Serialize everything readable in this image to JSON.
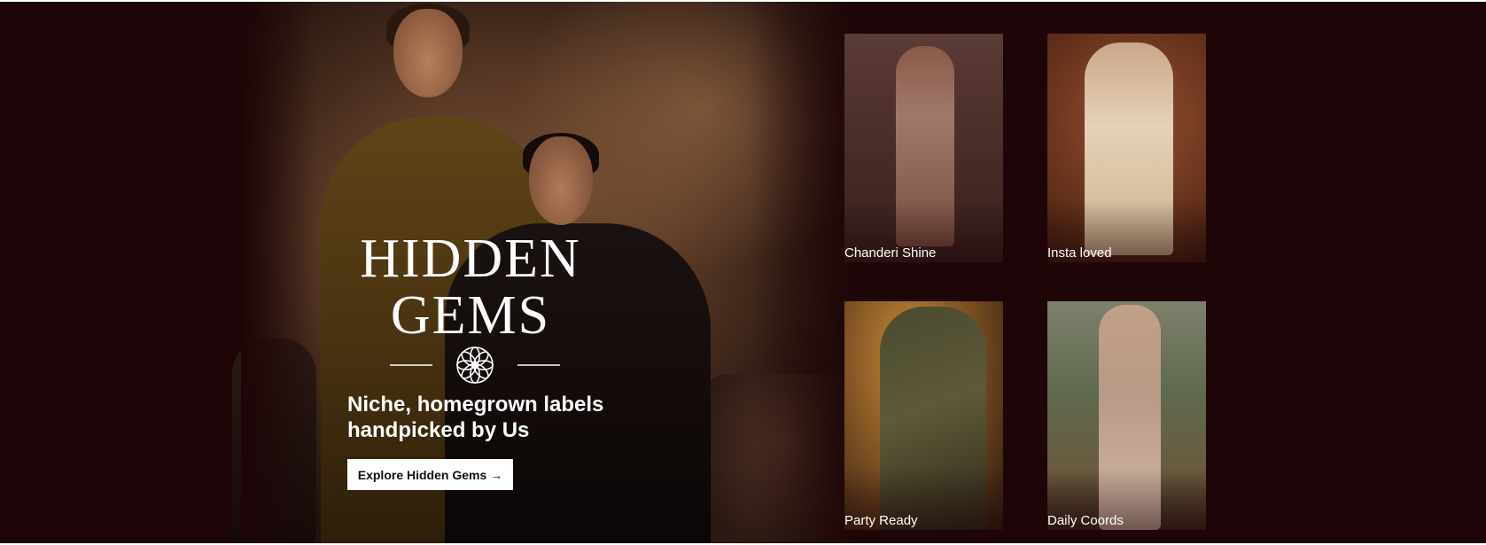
{
  "hero": {
    "logo_line1": "HIDDEN",
    "logo_line2": "GEMS",
    "tagline_line1": "Niche, homegrown labels",
    "tagline_line2": "handpicked by Us",
    "cta_label": "Explore Hidden Gems",
    "cta_arrow": "→"
  },
  "tiles": [
    {
      "label": "Chanderi Shine"
    },
    {
      "label": "Insta loved"
    },
    {
      "label": "Party Ready"
    },
    {
      "label": "Daily Coords"
    }
  ],
  "colors": {
    "background": "#1e0507",
    "text": "#ffffff",
    "button_bg": "#ffffff",
    "button_text": "#111111"
  }
}
